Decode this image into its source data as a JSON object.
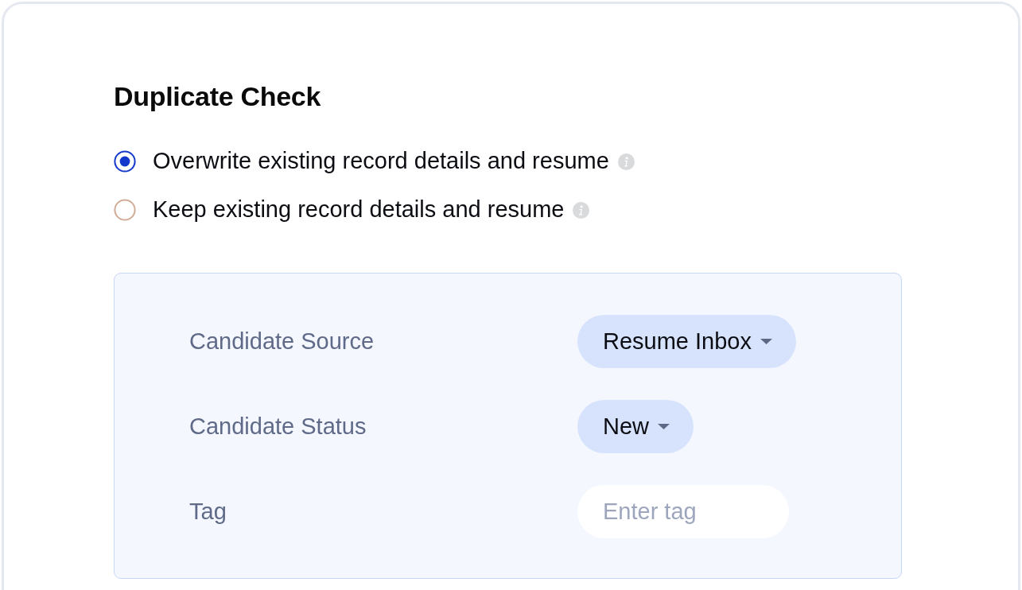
{
  "section": {
    "title": "Duplicate Check"
  },
  "options": [
    {
      "label": "Overwrite existing record details and resume",
      "selected": true
    },
    {
      "label": "Keep existing record details and resume",
      "selected": false
    }
  ],
  "fields": [
    {
      "label": "Candidate Source",
      "kind": "dropdown",
      "value": "Resume Inbox"
    },
    {
      "label": "Candidate Status",
      "kind": "dropdown",
      "value": "New"
    },
    {
      "label": "Tag",
      "kind": "input",
      "placeholder": "Enter tag"
    }
  ]
}
